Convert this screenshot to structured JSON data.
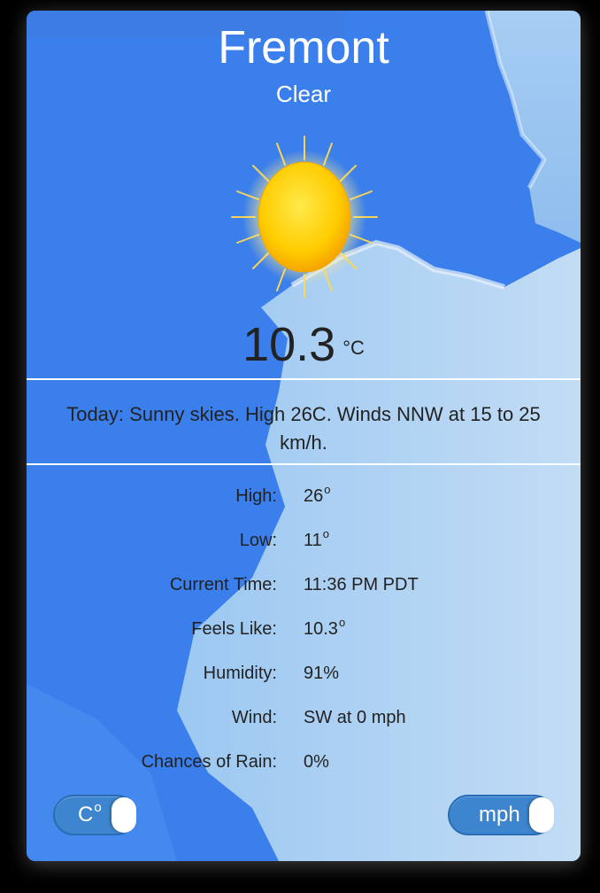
{
  "weather": {
    "city": "Fremont",
    "condition": "Clear",
    "icon": "sun-icon",
    "temperature": "10.3",
    "temperature_unit": "°C",
    "forecast": "Today: Sunny skies. High 26C. Winds NNW at 15 to 25 km/h."
  },
  "details": [
    {
      "label": "High:",
      "value": "26",
      "degree": "o"
    },
    {
      "label": "Low:",
      "value": "11",
      "degree": "o"
    },
    {
      "label": "Current Time:",
      "value": "11:36 PM PDT",
      "degree": ""
    },
    {
      "label": "Feels Like:",
      "value": "10.3",
      "degree": "o"
    },
    {
      "label": "Humidity:",
      "value": "91%",
      "degree": ""
    },
    {
      "label": "Wind:",
      "value": "SW at 0 mph",
      "degree": ""
    },
    {
      "label": "Chances of Rain:",
      "value": "0%",
      "degree": ""
    }
  ],
  "toggles": {
    "temperature_unit": {
      "label": "C",
      "degree": "o"
    },
    "wind_unit": {
      "label": "mph"
    }
  },
  "colors": {
    "sky": "#3d82ee",
    "toggle": "#3d86cf",
    "text_dark": "#222222",
    "text_light": "#ffffff"
  }
}
